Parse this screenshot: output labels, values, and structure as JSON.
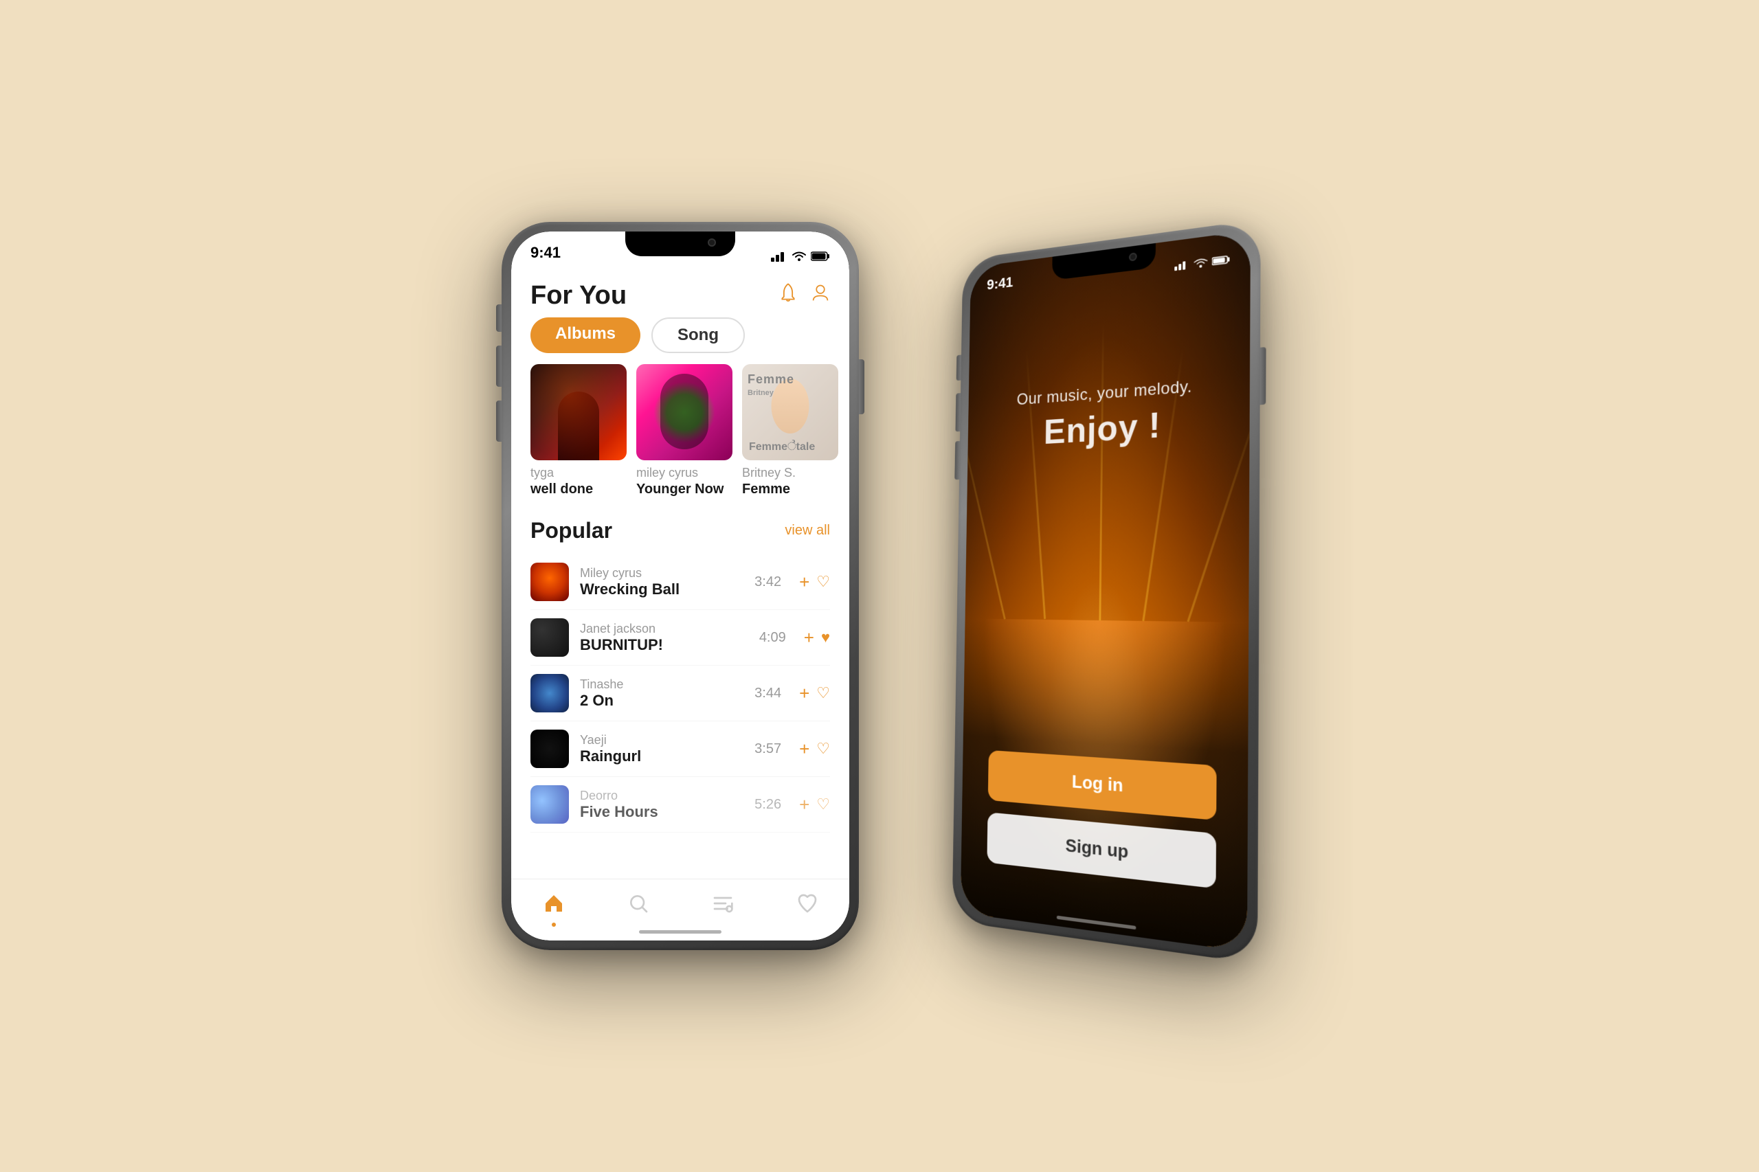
{
  "background": "#f0dfc0",
  "left_phone": {
    "status_bar": {
      "time": "9:41",
      "signal": "●●●",
      "wifi": "wifi",
      "battery": "battery"
    },
    "header": {
      "title": "For You",
      "bell_icon": "bell-icon",
      "user_icon": "user-icon"
    },
    "tabs": [
      {
        "label": "Albums",
        "active": true
      },
      {
        "label": "Song",
        "active": false
      }
    ],
    "albums": [
      {
        "artist": "tyga",
        "title": "well done",
        "cover_type": "tyga"
      },
      {
        "artist": "miley cyrus",
        "title": "Younger Now",
        "cover_type": "miley"
      },
      {
        "artist": "Britney S.",
        "title": "Femme",
        "cover_type": "britney"
      }
    ],
    "popular_section": {
      "title": "Popular",
      "view_all_label": "view all"
    },
    "songs": [
      {
        "artist": "Miley cyrus",
        "title": "Wrecking Ball",
        "duration": "3:42",
        "favorited": false,
        "thumb": "1"
      },
      {
        "artist": "Janet jackson",
        "title": "BURNITUP!",
        "duration": "4:09",
        "favorited": true,
        "thumb": "2"
      },
      {
        "artist": "Tinashe",
        "title": "2 On",
        "duration": "3:44",
        "favorited": false,
        "thumb": "3"
      },
      {
        "artist": "Yaeji",
        "title": "Raingurl",
        "duration": "3:57",
        "favorited": false,
        "thumb": "4"
      },
      {
        "artist": "Deorro",
        "title": "Five Hours",
        "duration": "5:26",
        "favorited": false,
        "thumb": "5"
      }
    ],
    "nav": [
      {
        "icon": "home-icon",
        "active": true,
        "label": "Home"
      },
      {
        "icon": "search-icon",
        "active": false,
        "label": "Search"
      },
      {
        "icon": "playlist-icon",
        "active": false,
        "label": "Playlist"
      },
      {
        "icon": "favorites-icon",
        "active": false,
        "label": "Favorites"
      }
    ]
  },
  "right_phone": {
    "status_bar": {
      "time": "9:41",
      "signal": "signal",
      "wifi": "wifi",
      "battery": "battery"
    },
    "tagline_sub": "Our music, your melody.",
    "tagline_main": "Enjoy !",
    "buttons": [
      {
        "label": "Log in",
        "type": "primary"
      },
      {
        "label": "Sign up",
        "type": "secondary"
      }
    ]
  }
}
